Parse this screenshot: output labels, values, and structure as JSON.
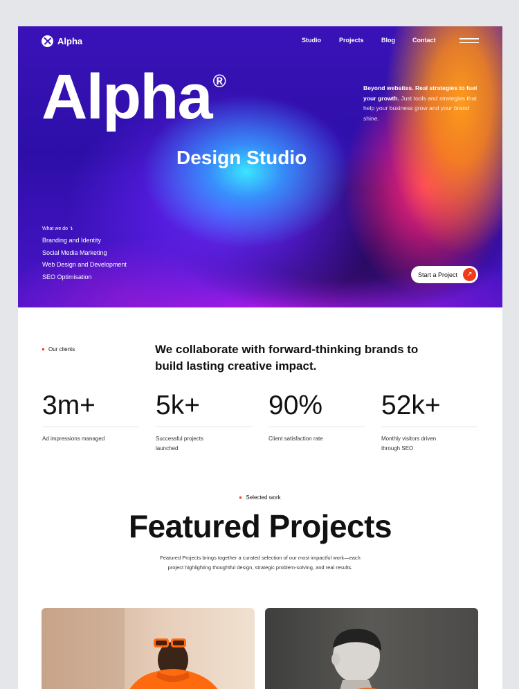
{
  "brand": {
    "name": "Alpha"
  },
  "nav": {
    "items": [
      "Studio",
      "Projects",
      "Blog",
      "Contact"
    ]
  },
  "hero": {
    "title": "Alpha",
    "title_mark": "®",
    "subtitle": "Design Studio",
    "tagline_bold": "Beyond websites. Real strategies to fuel your growth.",
    "tagline_rest": " Just tools and strategies that help your business grow and your brand shine.",
    "services_label": "What we do ↴",
    "services": [
      "Branding and Identity",
      "Social Media Marketing",
      "Web Design and Development",
      "SEO Optimisation"
    ],
    "cta_label": "Start a Project",
    "cta_icon": "↗"
  },
  "clients": {
    "label": "Our clients",
    "heading": "We collaborate with forward-thinking brands to build lasting creative impact.",
    "stats": [
      {
        "value": "3m+",
        "label": "Ad impressions managed"
      },
      {
        "value": "5k+",
        "label": "Successful projects launched"
      },
      {
        "value": "90%",
        "label": "Client satisfaction rate"
      },
      {
        "value": "52k+",
        "label": "Monthly visitors driven through SEO"
      }
    ]
  },
  "featured": {
    "label": "Selected work",
    "title": "Featured Projects",
    "description": "Featured Projects brings together a curated selection of our most impactful work—each project highlighting thoughtful design, strategic problem-solving, and real results."
  },
  "colors": {
    "accent": "#f03a1b",
    "hero_base": "#3a12b8"
  }
}
